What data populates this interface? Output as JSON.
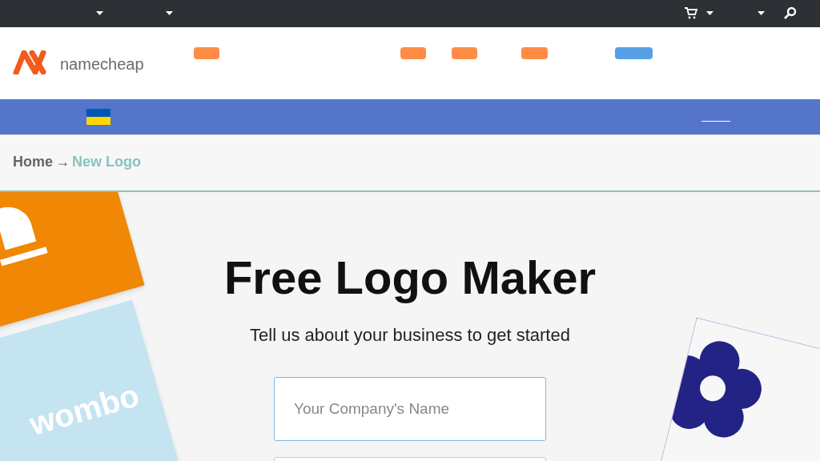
{
  "logo": {
    "text": "namecheap"
  },
  "breadcrumb": [
    {
      "label": "Home",
      "current": false
    },
    {
      "label": "New Logo",
      "current": true
    }
  ],
  "breadcrumb_separator": "→",
  "hero": {
    "title": "Free Logo Maker",
    "subtitle": "Tell us about your business to get started",
    "company_field": {
      "placeholder": "Your Company's Name"
    }
  },
  "sample_card": {
    "text": "wombo"
  }
}
